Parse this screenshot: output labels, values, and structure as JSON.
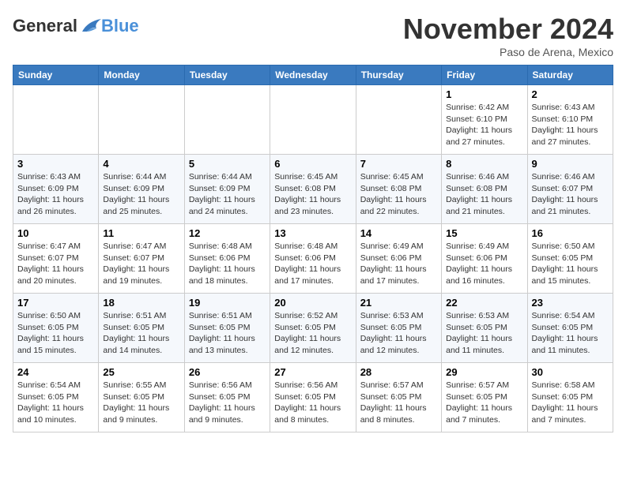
{
  "header": {
    "logo": {
      "general": "General",
      "blue": "Blue"
    },
    "title": "November 2024",
    "subtitle": "Paso de Arena, Mexico"
  },
  "days_of_week": [
    "Sunday",
    "Monday",
    "Tuesday",
    "Wednesday",
    "Thursday",
    "Friday",
    "Saturday"
  ],
  "weeks": [
    [
      {
        "day": "",
        "info": ""
      },
      {
        "day": "",
        "info": ""
      },
      {
        "day": "",
        "info": ""
      },
      {
        "day": "",
        "info": ""
      },
      {
        "day": "",
        "info": ""
      },
      {
        "day": "1",
        "info": "Sunrise: 6:42 AM\nSunset: 6:10 PM\nDaylight: 11 hours and 27 minutes."
      },
      {
        "day": "2",
        "info": "Sunrise: 6:43 AM\nSunset: 6:10 PM\nDaylight: 11 hours and 27 minutes."
      }
    ],
    [
      {
        "day": "3",
        "info": "Sunrise: 6:43 AM\nSunset: 6:09 PM\nDaylight: 11 hours and 26 minutes."
      },
      {
        "day": "4",
        "info": "Sunrise: 6:44 AM\nSunset: 6:09 PM\nDaylight: 11 hours and 25 minutes."
      },
      {
        "day": "5",
        "info": "Sunrise: 6:44 AM\nSunset: 6:09 PM\nDaylight: 11 hours and 24 minutes."
      },
      {
        "day": "6",
        "info": "Sunrise: 6:45 AM\nSunset: 6:08 PM\nDaylight: 11 hours and 23 minutes."
      },
      {
        "day": "7",
        "info": "Sunrise: 6:45 AM\nSunset: 6:08 PM\nDaylight: 11 hours and 22 minutes."
      },
      {
        "day": "8",
        "info": "Sunrise: 6:46 AM\nSunset: 6:08 PM\nDaylight: 11 hours and 21 minutes."
      },
      {
        "day": "9",
        "info": "Sunrise: 6:46 AM\nSunset: 6:07 PM\nDaylight: 11 hours and 21 minutes."
      }
    ],
    [
      {
        "day": "10",
        "info": "Sunrise: 6:47 AM\nSunset: 6:07 PM\nDaylight: 11 hours and 20 minutes."
      },
      {
        "day": "11",
        "info": "Sunrise: 6:47 AM\nSunset: 6:07 PM\nDaylight: 11 hours and 19 minutes."
      },
      {
        "day": "12",
        "info": "Sunrise: 6:48 AM\nSunset: 6:06 PM\nDaylight: 11 hours and 18 minutes."
      },
      {
        "day": "13",
        "info": "Sunrise: 6:48 AM\nSunset: 6:06 PM\nDaylight: 11 hours and 17 minutes."
      },
      {
        "day": "14",
        "info": "Sunrise: 6:49 AM\nSunset: 6:06 PM\nDaylight: 11 hours and 17 minutes."
      },
      {
        "day": "15",
        "info": "Sunrise: 6:49 AM\nSunset: 6:06 PM\nDaylight: 11 hours and 16 minutes."
      },
      {
        "day": "16",
        "info": "Sunrise: 6:50 AM\nSunset: 6:05 PM\nDaylight: 11 hours and 15 minutes."
      }
    ],
    [
      {
        "day": "17",
        "info": "Sunrise: 6:50 AM\nSunset: 6:05 PM\nDaylight: 11 hours and 15 minutes."
      },
      {
        "day": "18",
        "info": "Sunrise: 6:51 AM\nSunset: 6:05 PM\nDaylight: 11 hours and 14 minutes."
      },
      {
        "day": "19",
        "info": "Sunrise: 6:51 AM\nSunset: 6:05 PM\nDaylight: 11 hours and 13 minutes."
      },
      {
        "day": "20",
        "info": "Sunrise: 6:52 AM\nSunset: 6:05 PM\nDaylight: 11 hours and 12 minutes."
      },
      {
        "day": "21",
        "info": "Sunrise: 6:53 AM\nSunset: 6:05 PM\nDaylight: 11 hours and 12 minutes."
      },
      {
        "day": "22",
        "info": "Sunrise: 6:53 AM\nSunset: 6:05 PM\nDaylight: 11 hours and 11 minutes."
      },
      {
        "day": "23",
        "info": "Sunrise: 6:54 AM\nSunset: 6:05 PM\nDaylight: 11 hours and 11 minutes."
      }
    ],
    [
      {
        "day": "24",
        "info": "Sunrise: 6:54 AM\nSunset: 6:05 PM\nDaylight: 11 hours and 10 minutes."
      },
      {
        "day": "25",
        "info": "Sunrise: 6:55 AM\nSunset: 6:05 PM\nDaylight: 11 hours and 9 minutes."
      },
      {
        "day": "26",
        "info": "Sunrise: 6:56 AM\nSunset: 6:05 PM\nDaylight: 11 hours and 9 minutes."
      },
      {
        "day": "27",
        "info": "Sunrise: 6:56 AM\nSunset: 6:05 PM\nDaylight: 11 hours and 8 minutes."
      },
      {
        "day": "28",
        "info": "Sunrise: 6:57 AM\nSunset: 6:05 PM\nDaylight: 11 hours and 8 minutes."
      },
      {
        "day": "29",
        "info": "Sunrise: 6:57 AM\nSunset: 6:05 PM\nDaylight: 11 hours and 7 minutes."
      },
      {
        "day": "30",
        "info": "Sunrise: 6:58 AM\nSunset: 6:05 PM\nDaylight: 11 hours and 7 minutes."
      }
    ]
  ]
}
